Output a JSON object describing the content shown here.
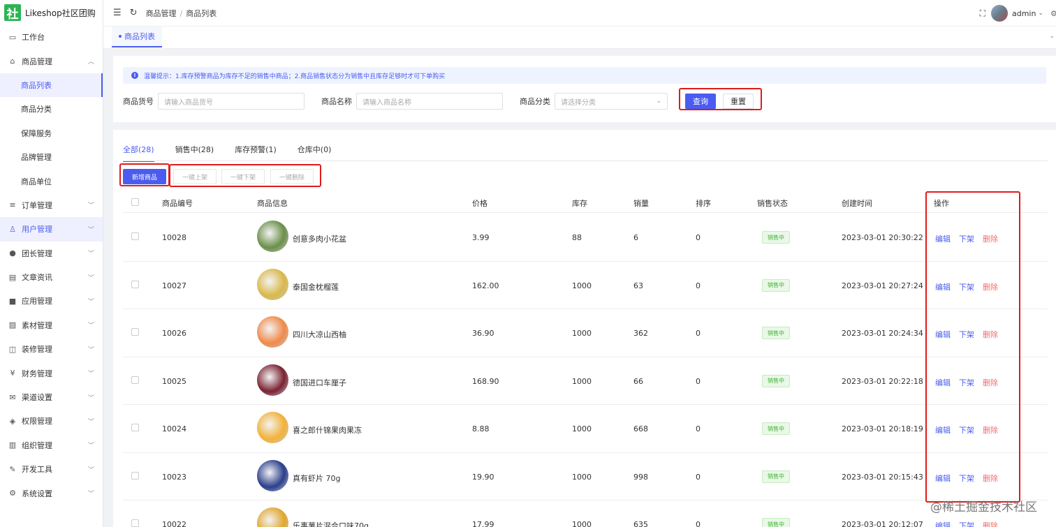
{
  "app": {
    "logo_char": "社",
    "name": "Likeshop社区团购"
  },
  "sidebar": {
    "items": [
      {
        "label": "工作台",
        "icon": "monitor-icon",
        "glyph": "▭",
        "level": 1,
        "expandable": false
      },
      {
        "label": "商品管理",
        "icon": "shop-icon",
        "glyph": "⌂",
        "level": 1,
        "expandable": true,
        "expanded": true
      },
      {
        "label": "商品列表",
        "level": 2,
        "active": true
      },
      {
        "label": "商品分类",
        "level": 2
      },
      {
        "label": "保障服务",
        "level": 2
      },
      {
        "label": "品牌管理",
        "level": 2
      },
      {
        "label": "商品单位",
        "level": 2
      },
      {
        "label": "订单管理",
        "icon": "list-icon",
        "glyph": "≡",
        "level": 1,
        "expandable": true
      },
      {
        "label": "用户管理",
        "icon": "user-icon",
        "glyph": "♙",
        "level": 1,
        "expandable": true,
        "highlight": true
      },
      {
        "label": "团长管理",
        "icon": "leader-icon",
        "glyph": "●",
        "level": 1,
        "expandable": true
      },
      {
        "label": "文章资讯",
        "icon": "article-icon",
        "glyph": "▤",
        "level": 1,
        "expandable": true
      },
      {
        "label": "应用管理",
        "icon": "apps-icon",
        "glyph": "■",
        "level": 1,
        "expandable": true
      },
      {
        "label": "素材管理",
        "icon": "image-icon",
        "glyph": "▨",
        "level": 1,
        "expandable": true
      },
      {
        "label": "装修管理",
        "icon": "decorate-icon",
        "glyph": "◫",
        "level": 1,
        "expandable": true
      },
      {
        "label": "财务管理",
        "icon": "finance-icon",
        "glyph": "¥",
        "level": 1,
        "expandable": true
      },
      {
        "label": "渠道设置",
        "icon": "channel-icon",
        "glyph": "✉",
        "level": 1,
        "expandable": true
      },
      {
        "label": "权限管理",
        "icon": "permission-icon",
        "glyph": "◈",
        "level": 1,
        "expandable": true
      },
      {
        "label": "组织管理",
        "icon": "org-icon",
        "glyph": "▥",
        "level": 1,
        "expandable": true
      },
      {
        "label": "开发工具",
        "icon": "dev-tools-icon",
        "glyph": "✎",
        "level": 1,
        "expandable": true
      },
      {
        "label": "系统设置",
        "icon": "settings-icon",
        "glyph": "⚙",
        "level": 1,
        "expandable": true
      }
    ]
  },
  "topbar": {
    "breadcrumb": [
      "商品管理",
      "商品列表"
    ],
    "username": "admin"
  },
  "tagbar": {
    "active_tag": "商品列表"
  },
  "filter": {
    "notice": "温馨提示：1.库存预警商品为库存不足的销售中商品；2.商品销售状态分为销售中且库存足够时才可下单购买",
    "code_label": "商品货号",
    "code_placeholder": "请输入商品货号",
    "name_label": "商品名称",
    "name_placeholder": "请输入商品名称",
    "category_label": "商品分类",
    "category_placeholder": "请选择分类",
    "query": "查询",
    "reset": "重置"
  },
  "tabs": [
    {
      "label": "全部(28)",
      "active": true
    },
    {
      "label": "销售中(28)"
    },
    {
      "label": "库存预警(1)"
    },
    {
      "label": "仓库中(0)"
    }
  ],
  "actions": {
    "add": "新增商品",
    "batch_on": "一键上架",
    "batch_off": "一键下架",
    "batch_delete": "一键删除"
  },
  "table": {
    "headers": [
      "商品编号",
      "商品信息",
      "价格",
      "库存",
      "销量",
      "排序",
      "销售状态",
      "创建时间",
      "操作"
    ],
    "row_actions": {
      "edit": "编辑",
      "off": "下架",
      "delete": "删除"
    },
    "rows": [
      {
        "code": "10028",
        "name": "创意多肉小花盆",
        "price": "3.99",
        "stock": "88",
        "sales": "6",
        "sort": "0",
        "status": "销售中",
        "created": "2023-03-01 20:30:22",
        "thumb_color": "#6b8f4a"
      },
      {
        "code": "10027",
        "name": "泰国金枕榴莲",
        "price": "162.00",
        "stock": "1000",
        "sales": "63",
        "sort": "0",
        "status": "销售中",
        "created": "2023-03-01 20:27:24",
        "thumb_color": "#d9b84a"
      },
      {
        "code": "10026",
        "name": "四川大凉山西柚",
        "price": "36.90",
        "stock": "1000",
        "sales": "362",
        "sort": "0",
        "status": "销售中",
        "created": "2023-03-01 20:24:34",
        "thumb_color": "#ef8a4a"
      },
      {
        "code": "10025",
        "name": "德国进口车厘子",
        "price": "168.90",
        "stock": "1000",
        "sales": "66",
        "sort": "0",
        "status": "销售中",
        "created": "2023-03-01 20:22:18",
        "thumb_color": "#7a2233"
      },
      {
        "code": "10024",
        "name": "喜之郎什锦果肉果冻",
        "price": "8.88",
        "stock": "1000",
        "sales": "668",
        "sort": "0",
        "status": "销售中",
        "created": "2023-03-01 20:18:19",
        "thumb_color": "#f2b23a"
      },
      {
        "code": "10023",
        "name": "真有虾片 70g",
        "price": "19.90",
        "stock": "1000",
        "sales": "998",
        "sort": "0",
        "status": "销售中",
        "created": "2023-03-01 20:15:43",
        "thumb_color": "#2a3f8c"
      },
      {
        "code": "10022",
        "name": "乐事薯片混合口味70g",
        "price": "17.99",
        "stock": "1000",
        "sales": "635",
        "sort": "0",
        "status": "销售中",
        "created": "2023-03-01 20:12:07",
        "thumb_color": "#e0a72e"
      }
    ]
  },
  "watermark": "@稀土掘金技术社区",
  "colors": {
    "primary": "#4a5cf0",
    "danger": "#f56c6c",
    "success": "#41b234",
    "highlight_box": "#e01b1b"
  }
}
